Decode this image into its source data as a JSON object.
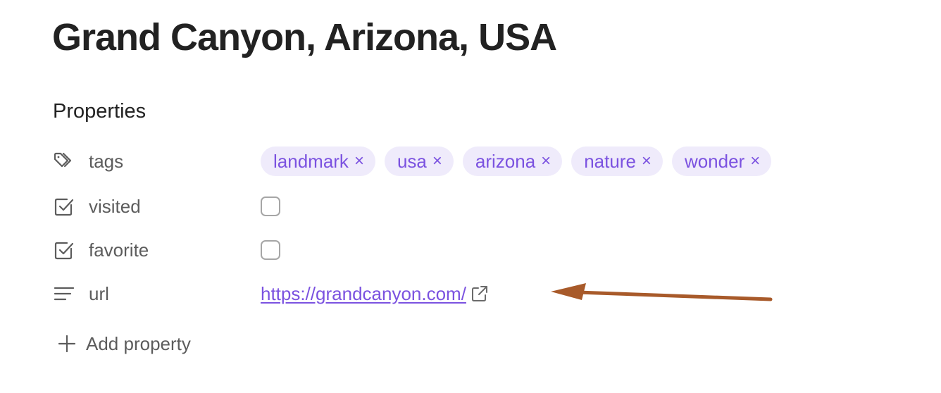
{
  "page": {
    "title": "Grand Canyon, Arizona, USA"
  },
  "properties": {
    "heading": "Properties",
    "tags": {
      "name": "tags",
      "icon": "tags-icon",
      "items": [
        {
          "label": "landmark",
          "remove": "×"
        },
        {
          "label": "usa",
          "remove": "×"
        },
        {
          "label": "arizona",
          "remove": "×"
        },
        {
          "label": "nature",
          "remove": "×"
        },
        {
          "label": "wonder",
          "remove": "×"
        }
      ]
    },
    "visited": {
      "name": "visited",
      "icon": "checkbox-icon",
      "checked": false
    },
    "favorite": {
      "name": "favorite",
      "icon": "checkbox-icon",
      "checked": false
    },
    "url": {
      "name": "url",
      "icon": "text-lines-icon",
      "value": "https://grandcanyon.com/",
      "link_icon": "external-link-icon"
    },
    "add": {
      "label": "Add property",
      "icon": "plus-icon"
    }
  },
  "colors": {
    "accent": "#7b52e0",
    "tag_background": "#efebfb",
    "annotation_arrow": "#a85a2a",
    "label_gray": "#5c5c5c"
  }
}
